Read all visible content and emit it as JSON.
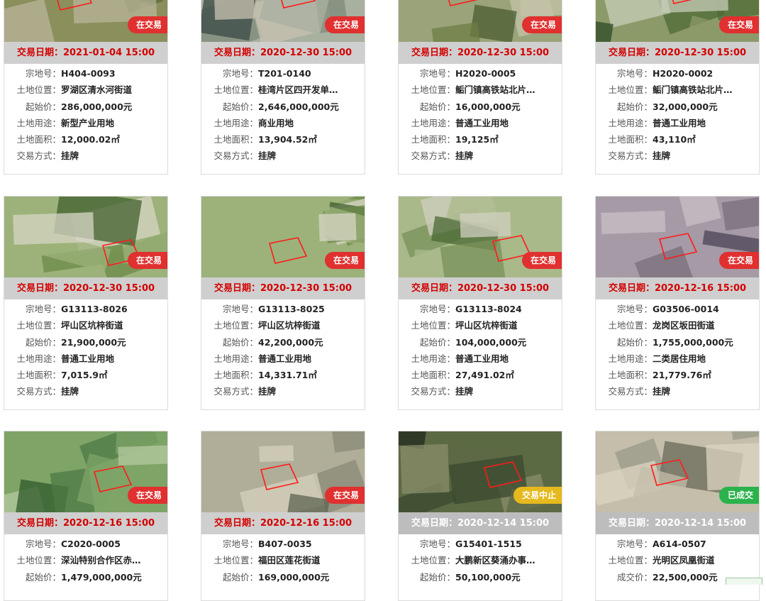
{
  "labels": {
    "date_prefix": "交易日期：",
    "lot_no": "宗地号：",
    "location": "土地位置：",
    "start_price": "起始价：",
    "deal_price": "成交价：",
    "land_use": "土地用途：",
    "area": "土地面积：",
    "method": "交易方式："
  },
  "colors": {
    "trading_badge": "#e0302f",
    "suspended_badge": "#e6b91e",
    "done_badge": "#2bb24c",
    "date_red": "#d40000"
  },
  "cards": [
    {
      "status": "在交易",
      "date": "2021-01-04 15:00",
      "lot": "H404-0093",
      "location": "罗湖区清水河街道",
      "price": "286,000,000元",
      "use": "新型产业用地",
      "area": "12,000.02㎡",
      "method": "挂牌"
    },
    {
      "status": "在交易",
      "date": "2020-12-30 15:00",
      "lot": "T201-0140",
      "location": "桂湾片区四开发单…",
      "price": "2,646,000,000元",
      "use": "商业用地",
      "area": "13,904.52㎡",
      "method": "挂牌"
    },
    {
      "status": "在交易",
      "date": "2020-12-30 15:00",
      "lot": "H2020-0005",
      "location": "鲘门镇高铁站北片…",
      "price": "16,000,000元",
      "use": "普通工业用地",
      "area": "19,125㎡",
      "method": "挂牌"
    },
    {
      "status": "在交易",
      "date": "2020-12-30 15:00",
      "lot": "H2020-0002",
      "location": "鲘门镇高铁站北片…",
      "price": "32,000,000元",
      "use": "普通工业用地",
      "area": "43,110㎡",
      "method": "挂牌"
    },
    {
      "status": "在交易",
      "date": "2020-12-30 15:00",
      "lot": "G13113-8026",
      "location": "坪山区坑梓街道",
      "price": "21,900,000元",
      "use": "普通工业用地",
      "area": "7,015.9㎡",
      "method": "挂牌"
    },
    {
      "status": "在交易",
      "date": "2020-12-30 15:00",
      "lot": "G13113-8025",
      "location": "坪山区坑梓街道",
      "price": "42,200,000元",
      "use": "普通工业用地",
      "area": "14,331.71㎡",
      "method": "挂牌"
    },
    {
      "status": "在交易",
      "date": "2020-12-30 15:00",
      "lot": "G13113-8024",
      "location": "坪山区坑梓街道",
      "price": "104,000,000元",
      "use": "普通工业用地",
      "area": "27,491.02㎡",
      "method": "挂牌"
    },
    {
      "status": "在交易",
      "date": "2020-12-16 15:00",
      "lot": "G03506-0014",
      "location": "龙岗区坂田街道",
      "price": "1,755,000,000元",
      "use": "二类居住用地",
      "area": "21,779.76㎡",
      "method": "挂牌"
    },
    {
      "status": "在交易",
      "date": "2020-12-16 15:00",
      "lot": "C2020-0005",
      "location": "深汕特别合作区赤…",
      "price": "1,479,000,000元"
    },
    {
      "status": "在交易",
      "date": "2020-12-16 15:00",
      "lot": "B407-0035",
      "location": "福田区莲花街道",
      "price": "169,000,000元"
    },
    {
      "status": "交易中止",
      "date": "2020-12-14 15:00",
      "lot": "G15401-1515",
      "location": "大鹏新区葵涌办事…",
      "price": "50,100,000元"
    },
    {
      "status": "已成交",
      "date": "2020-12-14 15:00",
      "lot": "A614-0507",
      "location": "光明区凤凰街道",
      "price": "22,500,000元"
    }
  ]
}
